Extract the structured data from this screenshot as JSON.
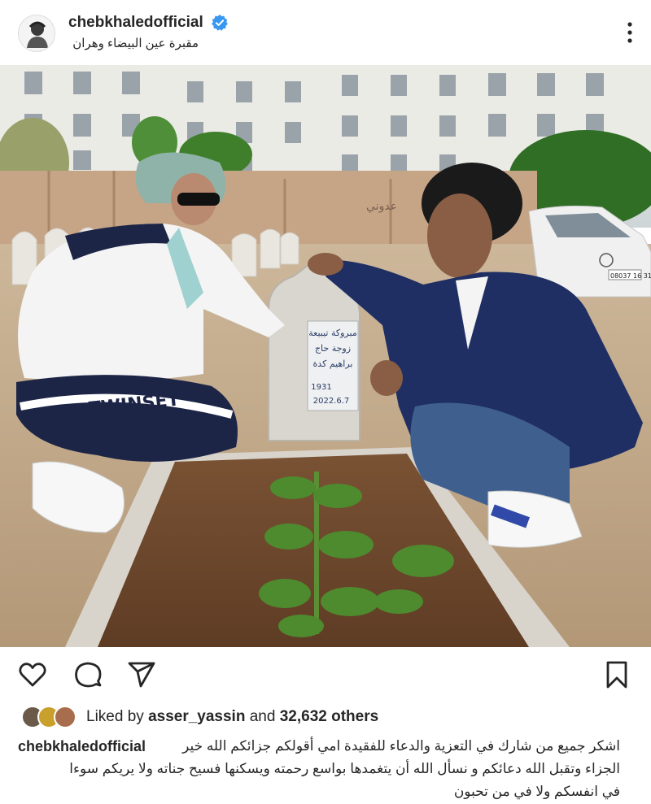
{
  "post": {
    "username": "chebkhaledofficial",
    "location": "مقبرة عين البيضاء وهران",
    "verified": true,
    "accent_color": "#3897f0"
  },
  "photo": {
    "tombstone_line1": "مبروكة تيبيعة",
    "tombstone_line2": "زوجة حاج",
    "tombstone_line3": "براهيم كدة",
    "tombstone_year": "1931",
    "tombstone_date": "2022.6.7",
    "jacket_text": "TWINSET",
    "wall_text": "عدوني",
    "license_plate": "08037 16 31"
  },
  "actions": {
    "like_icon": "heart-icon",
    "comment_icon": "comment-icon",
    "share_icon": "share-icon",
    "save_icon": "bookmark-icon"
  },
  "likes": {
    "prefix": "Liked by",
    "user": "asser_yassin",
    "middle": "and",
    "count": "32,632 others"
  },
  "caption": {
    "username": "chebkhaledofficial",
    "line1": "اشكر جميع من شارك في التعزية والدعاء للفقيدة امي أقولكم جزائكم الله خير",
    "line2": "الجزاء وتقبل الله دعائكم و نسأل الله أن يتغمدها بواسع رحمته ويسكنها فسيح جناته ولا يريكم سوءا",
    "line3": "في انفسكم ولا في من  تحبون"
  }
}
